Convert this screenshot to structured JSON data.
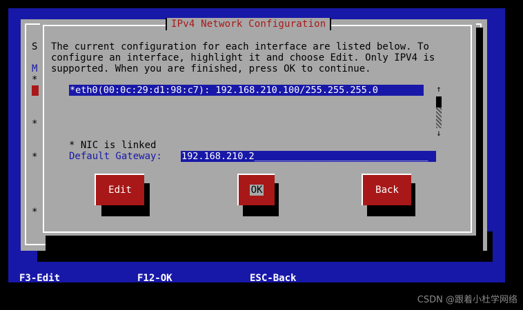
{
  "background_dialog": {
    "visible_chars": [
      "S",
      "M",
      "*",
      "*",
      "*",
      "*"
    ]
  },
  "dialog": {
    "title": "IPv4 Network Configuration",
    "description_lines": [
      "The current configuration for each interface are listed below. To",
      "configure an interface, highlight it and choose Edit. Only IPV4 is",
      "supported. When you are finished, press OK to continue."
    ],
    "interfaces": [
      "*eth0(00:0c:29:d1:98:c7): 192.168.210.100/255.255.255.0"
    ],
    "scroll_up": "↑",
    "scroll_down": "↓",
    "status": "* NIC is linked",
    "gateway_label": "Default Gateway:",
    "gateway_value": "192.168.210.2_______________________________"
  },
  "buttons": {
    "edit": "Edit",
    "ok": "OK",
    "back": "Back"
  },
  "footer": {
    "f3": "F3-Edit",
    "f12": "F12-OK",
    "esc": "ESC-Back"
  },
  "watermark": "CSDN @跟着小杜学网络",
  "colors": {
    "screen": "#1818a8",
    "dialog": "#a8a8a8",
    "button": "#a81818",
    "title": "#a81818"
  }
}
